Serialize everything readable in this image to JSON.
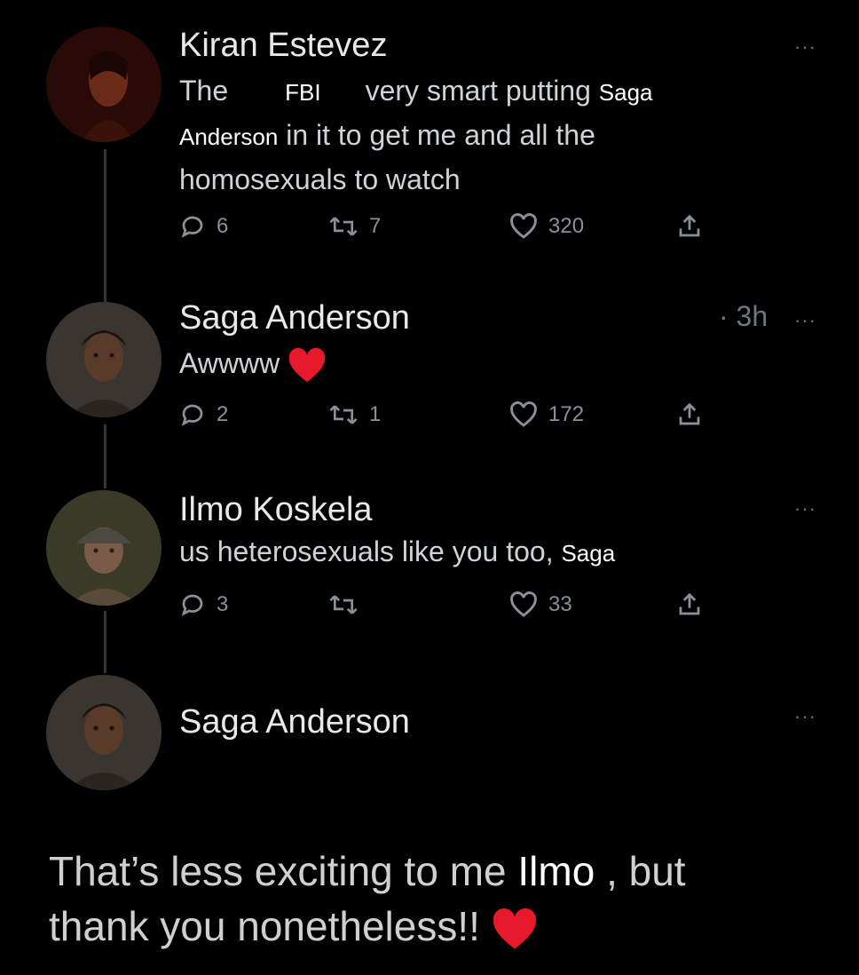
{
  "tweets": [
    {
      "author": "Kiran Estevez",
      "body": {
        "part1": "The",
        "fbi": "FBI",
        "part2": "very smart putting",
        "saga1": "Saga",
        "anderson": "Anderson",
        "line2": " in it to get me and all the",
        "line3": "homosexuals to watch"
      },
      "replies": "6",
      "retweets": "7",
      "likes": "320",
      "more": "···"
    },
    {
      "author": "Saga Anderson",
      "time": "· 3h",
      "body": "Awwww",
      "replies": "2",
      "retweets": "1",
      "likes": "172",
      "more": "···"
    },
    {
      "author": "Ilmo Koskela",
      "body": {
        "text": "us heterosexuals like you too,",
        "saga": "Saga"
      },
      "replies": "3",
      "retweets": "",
      "likes": "33",
      "more": "···"
    },
    {
      "author": "Saga Anderson",
      "more": "···"
    }
  ],
  "final_reply": {
    "part1": "That’s less exciting to me",
    "ilmo": "Ilmo",
    "part2": ", but",
    "line2": "thank you nonetheless!!"
  },
  "colors": {
    "background": "#000000",
    "text": "#e7e9ea",
    "muted": "#71767b",
    "heart": "#e8192c"
  },
  "icons": [
    "reply-icon",
    "retweet-icon",
    "like-icon",
    "share-icon",
    "more-icon",
    "heart-emoji"
  ]
}
